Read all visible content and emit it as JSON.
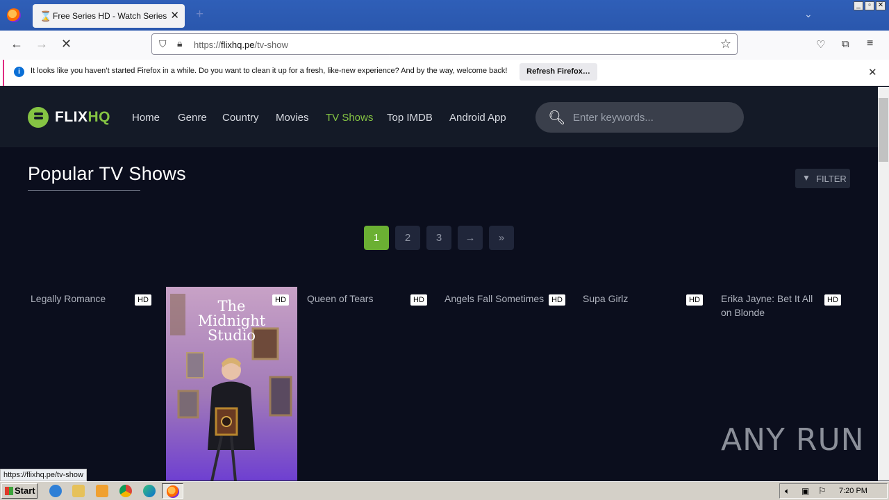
{
  "browser": {
    "tab_title": "Free Series HD - Watch Series and",
    "url_prefix": "https://",
    "url_host": "flixhq.pe",
    "url_path": "/tv-show",
    "notification_text": "It looks like you haven’t started Firefox in a while. Do you want to clean it up for a fresh, like-new experience? And by the way, welcome back!",
    "notification_button": "Refresh Firefox…",
    "status_url": "https://flixhq.pe/tv-show"
  },
  "site": {
    "logo_main": "FLIX",
    "logo_accent": "HQ",
    "accent_color": "#85c443",
    "menu": [
      {
        "label": "Home"
      },
      {
        "label": "Genre"
      },
      {
        "label": "Country"
      },
      {
        "label": "Movies"
      },
      {
        "label": "TV Shows",
        "active": true
      },
      {
        "label": "Top IMDB"
      },
      {
        "label": "Android App"
      }
    ],
    "search_placeholder": "Enter keywords..."
  },
  "main": {
    "section_title": "Popular TV Shows",
    "filter_label": "FILTER",
    "pagination": [
      "1",
      "2",
      "3",
      "→",
      "»"
    ],
    "active_page": "1",
    "cards": [
      {
        "title": "Legally Romance",
        "badge": "HD"
      },
      {
        "title": "",
        "badge": "HD",
        "poster_title": "The Midnight Studio"
      },
      {
        "title": "Queen of Tears",
        "badge": "HD"
      },
      {
        "title": "Angels Fall Sometimes",
        "badge": "HD"
      },
      {
        "title": "Supa Girlz",
        "badge": "HD"
      },
      {
        "title": "Erika Jayne: Bet It All on Blonde",
        "badge": "HD"
      }
    ]
  },
  "taskbar": {
    "start_label": "Start",
    "clock": "7:20 PM"
  },
  "watermark": "ANY RUN"
}
